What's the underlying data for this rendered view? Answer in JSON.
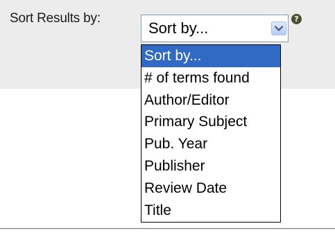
{
  "sort": {
    "label": "Sort Results by:",
    "selected_value": "Sort by...",
    "options": [
      "Sort by...",
      "# of terms found",
      "Author/Editor",
      "Primary Subject",
      "Pub. Year",
      "Publisher",
      "Review Date",
      "Title"
    ],
    "selected_index": 0
  },
  "help": {
    "glyph": "?"
  },
  "icons": {
    "dropdown": "chevron-down-icon",
    "help": "help-icon"
  },
  "colors": {
    "panel_background": "#ececec",
    "selection_highlight": "#316ac5",
    "select_border": "#7f9db9",
    "help_icon": "#4a5232"
  }
}
